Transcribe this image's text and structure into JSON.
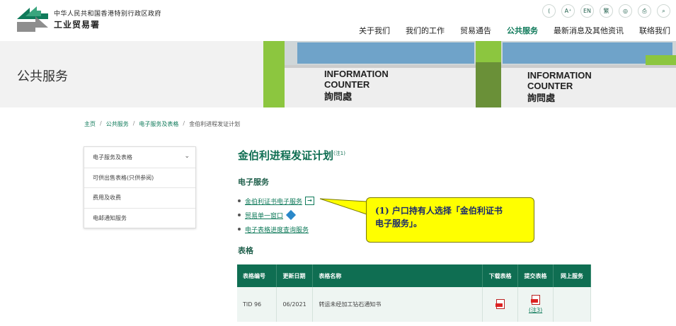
{
  "header": {
    "org_line1": "中华人民共和国香港特别行政区政府",
    "org_line2": "工业贸易署",
    "tools": [
      {
        "icon": "share-icon",
        "label": "⟨"
      },
      {
        "icon": "font-size-icon",
        "label": "A⁺"
      },
      {
        "icon": "english-icon",
        "label": "EN"
      },
      {
        "icon": "traditional-chinese-icon",
        "label": "繁"
      },
      {
        "icon": "globe-icon",
        "label": "◎"
      },
      {
        "icon": "print-icon",
        "label": "⎙"
      },
      {
        "icon": "search-icon",
        "label": "⌕"
      }
    ],
    "nav": [
      {
        "label": "关于我们",
        "active": false
      },
      {
        "label": "我们的工作",
        "active": false
      },
      {
        "label": "贸易通告",
        "active": false
      },
      {
        "label": "公共服务",
        "active": true
      },
      {
        "label": "最新消息及其他资讯",
        "active": false
      },
      {
        "label": "联络我们",
        "active": false
      }
    ]
  },
  "banner": {
    "title": "公共服务",
    "counter1_line1": "INFORMATION",
    "counter1_line2": "COUNTER",
    "counter1_line3": "詢問處",
    "counter2_line1": "INFORMATION",
    "counter2_line2": "COUNTER",
    "counter2_line3": "詢問處"
  },
  "breadcrumb": [
    "主页",
    "公共服务",
    "电子服务及表格",
    "金伯利进程发证计划"
  ],
  "side_menu": {
    "items": [
      {
        "label": "电子服务及表格",
        "expandable": true
      },
      {
        "label": "可供出售表格(只供参阅)"
      },
      {
        "label": "费用及收费"
      },
      {
        "label": "电邮通知服务"
      }
    ]
  },
  "main": {
    "title": "金伯利进程发证计划",
    "title_note": "(注1)",
    "eservices_heading": "电子服务",
    "eservices": [
      {
        "label": "金伯利证书电子服务",
        "icon": "login-arrow-icon",
        "icon_label": "→"
      },
      {
        "label": "贸易单一窗口",
        "icon": "single-window-logo-icon",
        "icon_label": ""
      },
      {
        "label": "电子表格进度查询服务",
        "icon": "",
        "icon_label": ""
      }
    ],
    "forms_heading": "表格"
  },
  "callout": {
    "line1": "(1) 户口持有人选择「金伯利证书",
    "line2": "电子服务」。",
    "background": "#ffff00"
  },
  "table": {
    "headers": [
      "表格编号",
      "更新日期",
      "表格名称",
      "下载表格",
      "提交表格",
      "网上服务"
    ],
    "rows": [
      {
        "form_no": "TID 96",
        "date": "06/2021",
        "name": "转运未经加工钻石通知书",
        "submit_note": "(注3)"
      }
    ]
  },
  "colors": {
    "brand_green": "#0f6e52",
    "link_green": "#0f7a5a"
  }
}
